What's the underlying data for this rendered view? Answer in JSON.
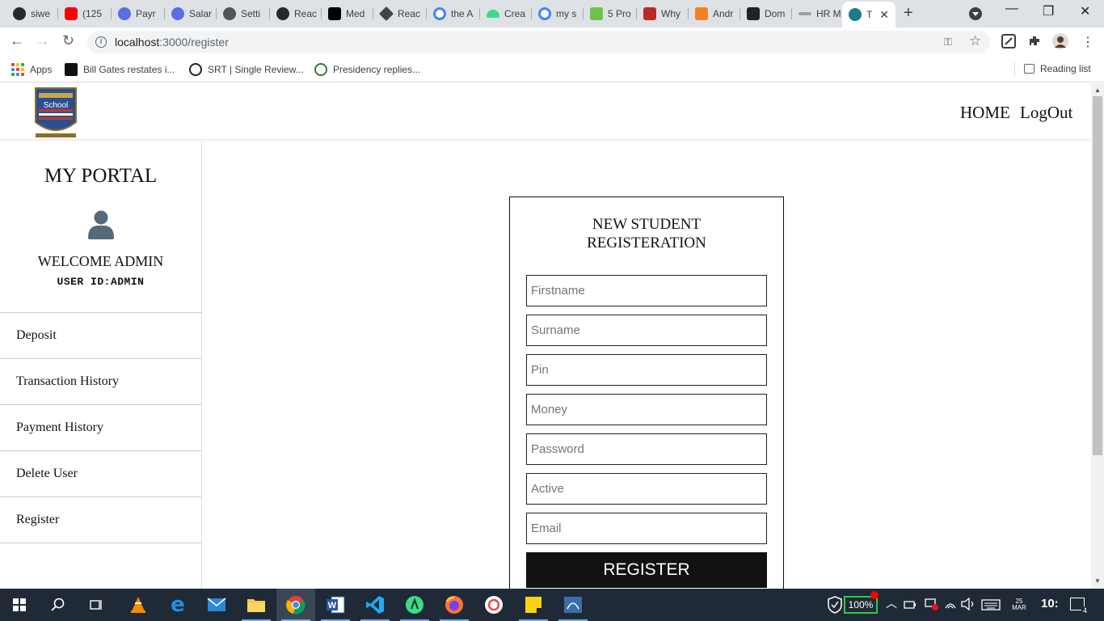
{
  "browser": {
    "tabs": [
      {
        "label": "siwe",
        "color": "#24292f"
      },
      {
        "label": "(125",
        "color": "#ff0000"
      },
      {
        "label": "Payr",
        "color": "#5b6ee1"
      },
      {
        "label": "Salar",
        "color": "#5b6ee1"
      },
      {
        "label": "Setti",
        "color": "#555555"
      },
      {
        "label": "Reac",
        "color": "#24292f"
      },
      {
        "label": "Med",
        "color": "#000000"
      },
      {
        "label": "Reac",
        "color": "#444444"
      },
      {
        "label": "the A",
        "color": "#4285f4"
      },
      {
        "label": "Crea",
        "color": "#3ddc84"
      },
      {
        "label": "my s",
        "color": "#4285f4"
      },
      {
        "label": "5 Pro",
        "color": "#6cc24a"
      },
      {
        "label": "Why",
        "color": "#b92b27"
      },
      {
        "label": "Andr",
        "color": "#f48024"
      },
      {
        "label": "Dom",
        "color": "#222222"
      },
      {
        "label": "HR M",
        "color": "#9aa0a6"
      },
      {
        "label": "T",
        "color": "#1b7a8c"
      }
    ],
    "new_tab": "+",
    "window_controls": {
      "minimize": "—",
      "restore": "❐",
      "close": "✕"
    },
    "url_host": "localhost",
    "url_path": ":3000/register",
    "bookmarks": [
      {
        "label": "Apps"
      },
      {
        "label": "Bill Gates restates i..."
      },
      {
        "label": "SRT | Single Review..."
      },
      {
        "label": "Presidency replies..."
      }
    ],
    "reading_list": "Reading list"
  },
  "header": {
    "logo_text": "School",
    "nav": {
      "home": "HOME",
      "logout": "LogOut"
    }
  },
  "sidebar": {
    "title": "MY PORTAL",
    "welcome": "WELCOME ADMIN",
    "user_id": "USER ID:ADMIN",
    "menu": [
      "Deposit",
      "Transaction History",
      "Payment History",
      "Delete User",
      "Register"
    ]
  },
  "form": {
    "title_line1": "NEW STUDENT",
    "title_line2": "REGISTERATION",
    "fields": [
      "Firstname",
      "Surname",
      "Pin",
      "Money",
      "Password",
      "Active",
      "Email"
    ],
    "submit": "REGISTER"
  },
  "taskbar": {
    "battery": "100%",
    "date": "25 MAR",
    "time": "10:",
    "notifications": "4"
  },
  "colors": {
    "chrome_bg": "#dee1e6",
    "taskbar_bg": "#1f2a36",
    "button_bg": "#111111",
    "user_icon": "#546a7b"
  }
}
